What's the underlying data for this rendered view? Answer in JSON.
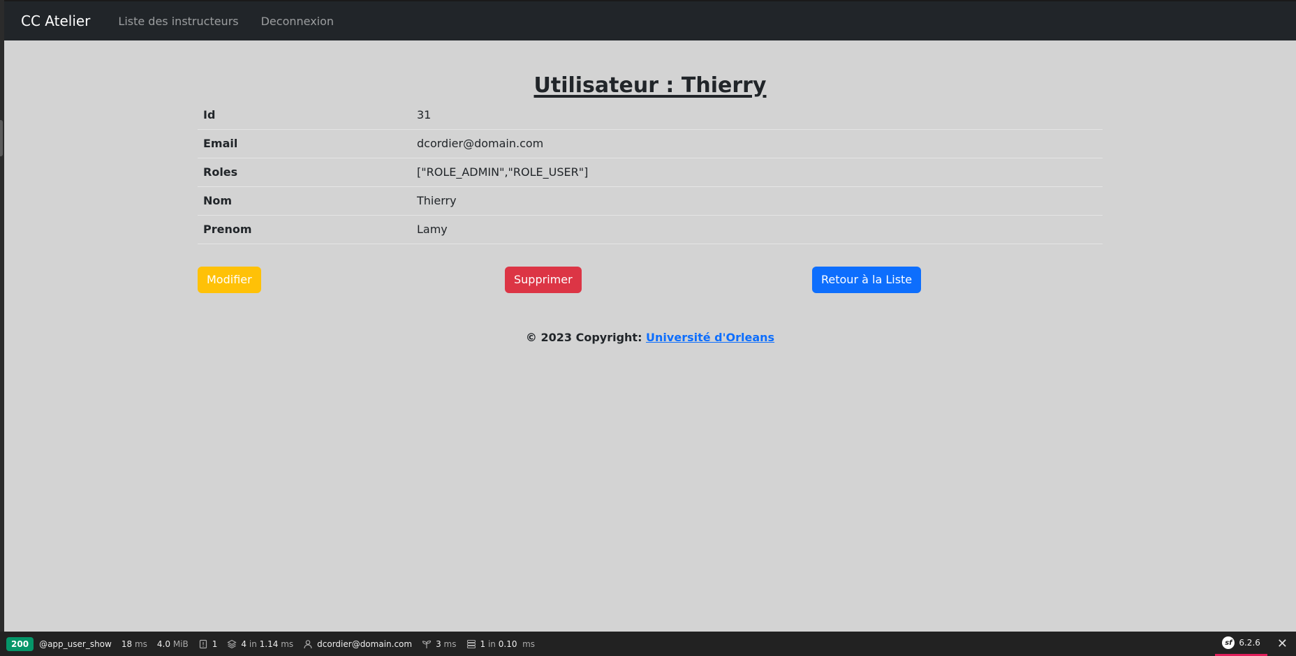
{
  "navbar": {
    "brand": "CC Atelier",
    "links": [
      "Liste des instructeurs",
      "Deconnexion"
    ]
  },
  "page_title": "Utilisateur : Thierry",
  "details": [
    {
      "label": "Id",
      "value": "31"
    },
    {
      "label": "Email",
      "value": "dcordier@domain.com"
    },
    {
      "label": "Roles",
      "value": "[\"ROLE_ADMIN\",\"ROLE_USER\"]"
    },
    {
      "label": "Nom",
      "value": "Thierry"
    },
    {
      "label": "Prenom",
      "value": "Lamy"
    }
  ],
  "actions": {
    "edit": "Modifier",
    "delete": "Supprimer",
    "back": "Retour à la Liste"
  },
  "footer": {
    "prefix": "© 2023 Copyright: ",
    "link": "Université d'Orleans"
  },
  "debug_toolbar": {
    "status": "200",
    "route": "@app_user_show",
    "time_value": "18",
    "time_unit": "ms",
    "memory_value": "4.0",
    "memory_unit": "MiB",
    "logs": "1",
    "twig_count": "4",
    "twig_in": "in",
    "twig_time": "1.14",
    "twig_unit": "ms",
    "user": "dcordier@domain.com",
    "events_time": "3",
    "events_unit": "ms",
    "db_count": "1",
    "db_in": "in",
    "db_time": "0.10",
    "db_unit": "ms",
    "symfony_version": "6.2.6"
  }
}
